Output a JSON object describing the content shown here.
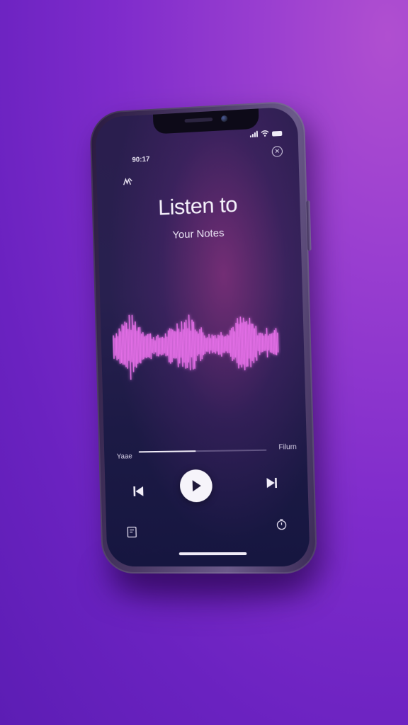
{
  "status_bar": {
    "time": "90:17",
    "icons": [
      "signal-icon",
      "wifi-icon",
      "battery-icon"
    ]
  },
  "header": {
    "close_icon": "close-icon",
    "top_left_icon": "pen-icon"
  },
  "main": {
    "title": "Listen to",
    "subtitle": "Your Notes"
  },
  "player": {
    "elapsed_label": "Yaae",
    "remaining_label": "Filurn",
    "progress_fraction": 0.45,
    "controls": [
      "skip-previous-icon",
      "play-icon",
      "skip-next-icon"
    ]
  },
  "footer": {
    "left_icon": "note-icon",
    "right_icon": "timer-icon"
  },
  "colors": {
    "background": "#7e2bcb",
    "waveform": "#e36ee6",
    "screen": "#1c1a45",
    "play_button": "#f6f4fa"
  }
}
